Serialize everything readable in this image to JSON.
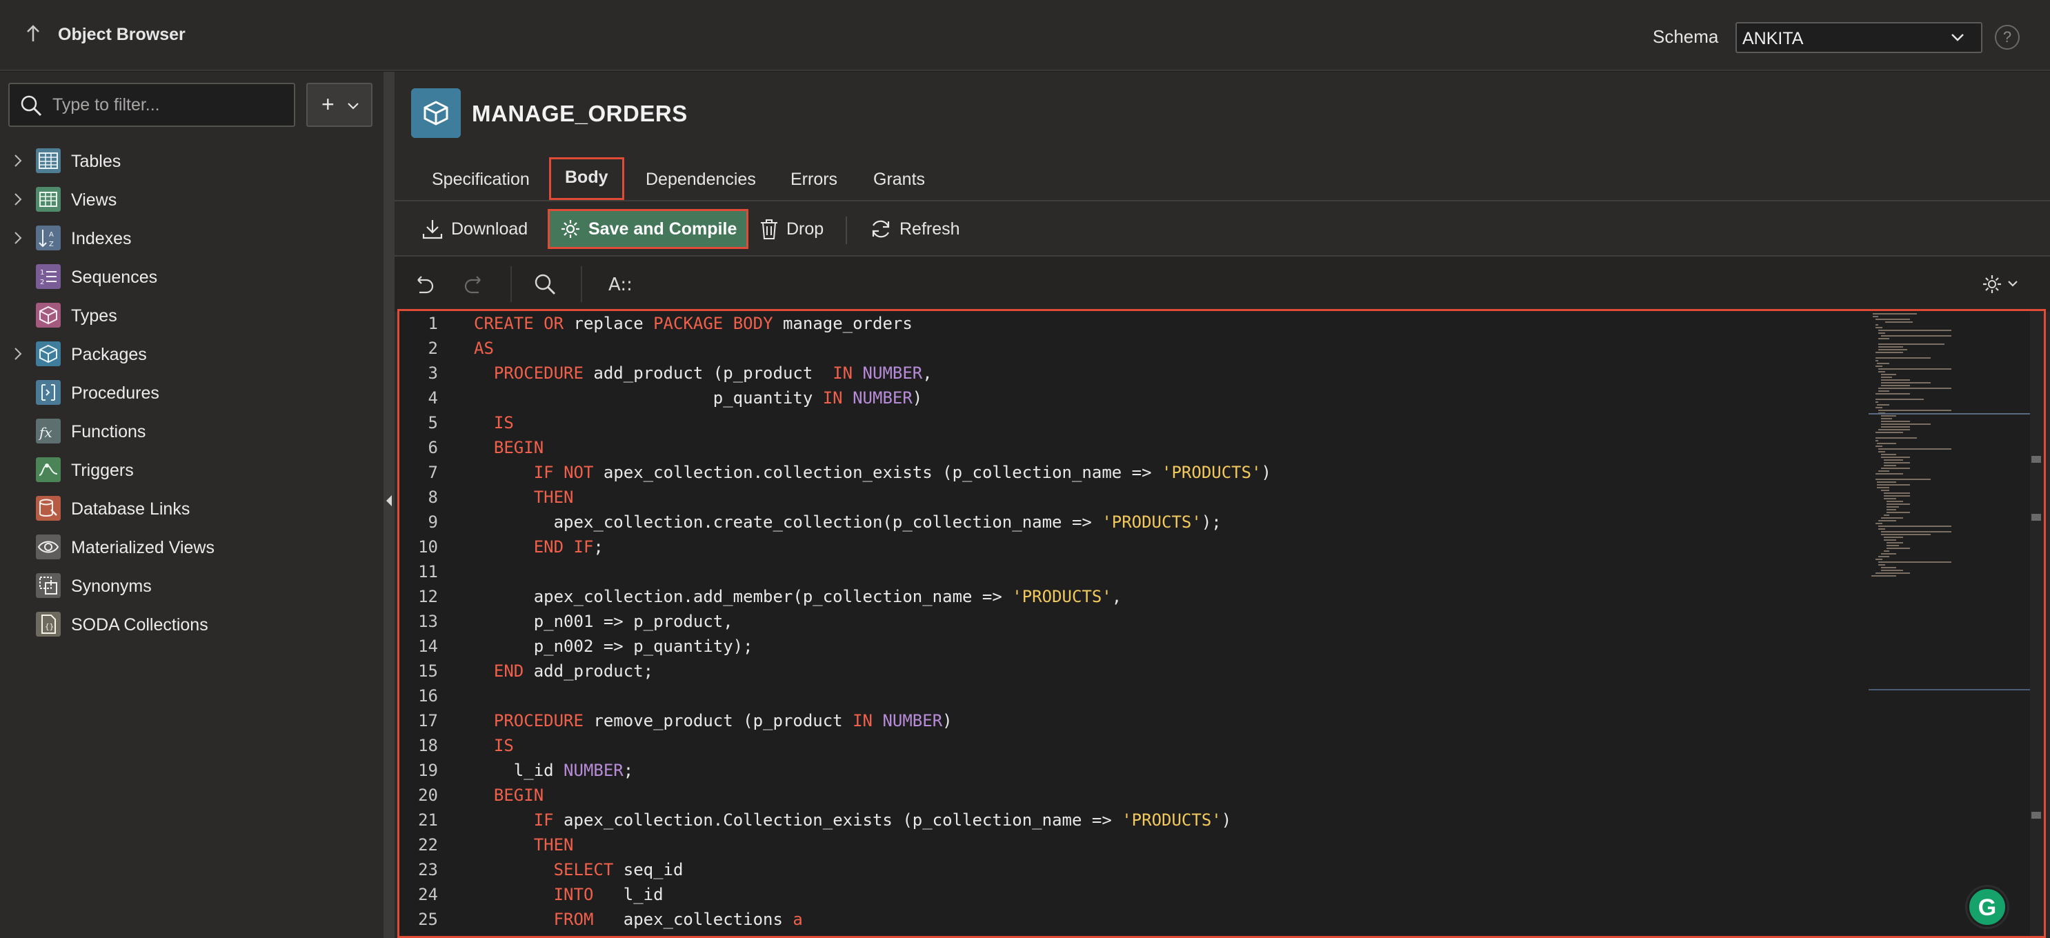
{
  "topbar": {
    "title": "Object Browser",
    "schema_label": "Schema",
    "schema_value": "ANKITA",
    "help": "?"
  },
  "sidebar": {
    "filter_placeholder": "Type to filter...",
    "add_label": "+",
    "items": [
      {
        "label": "Tables",
        "icon": "table-icon",
        "expandable": true
      },
      {
        "label": "Views",
        "icon": "view-icon",
        "expandable": true
      },
      {
        "label": "Indexes",
        "icon": "index-icon",
        "expandable": true
      },
      {
        "label": "Sequences",
        "icon": "sequence-icon",
        "expandable": false
      },
      {
        "label": "Types",
        "icon": "type-icon",
        "expandable": false
      },
      {
        "label": "Packages",
        "icon": "package-icon",
        "expandable": true
      },
      {
        "label": "Procedures",
        "icon": "procedure-icon",
        "expandable": false
      },
      {
        "label": "Functions",
        "icon": "function-icon",
        "expandable": false
      },
      {
        "label": "Triggers",
        "icon": "trigger-icon",
        "expandable": false
      },
      {
        "label": "Database Links",
        "icon": "database-link-icon",
        "expandable": false
      },
      {
        "label": "Materialized Views",
        "icon": "materialized-view-icon",
        "expandable": false
      },
      {
        "label": "Synonyms",
        "icon": "synonym-icon",
        "expandable": false
      },
      {
        "label": "SODA Collections",
        "icon": "soda-collection-icon",
        "expandable": false
      }
    ]
  },
  "object": {
    "name": "MANAGE_ORDERS"
  },
  "tabs": [
    {
      "label": "Specification"
    },
    {
      "label": "Body",
      "active": true
    },
    {
      "label": "Dependencies"
    },
    {
      "label": "Errors"
    },
    {
      "label": "Grants"
    }
  ],
  "toolbar": {
    "download": "Download",
    "save_compile": "Save and Compile",
    "drop": "Drop",
    "refresh": "Refresh"
  },
  "editor_toolbar": {
    "font_glyph": "A::"
  },
  "code": {
    "line_numbers": [
      "1",
      "2",
      "3",
      "4",
      "5",
      "6",
      "7",
      "8",
      "9",
      "10",
      "11",
      "12",
      "13",
      "14",
      "15",
      "16",
      "17",
      "18",
      "19",
      "20",
      "21",
      "22",
      "23",
      "24",
      "25"
    ]
  },
  "colors": {
    "accent_red": "#e04b38",
    "save_green": "#45785a",
    "keyword": "#f0604b",
    "type": "#b88cd8",
    "string": "#f2c95c",
    "package_icon": "#3f7d9c"
  },
  "grammarly": "G"
}
